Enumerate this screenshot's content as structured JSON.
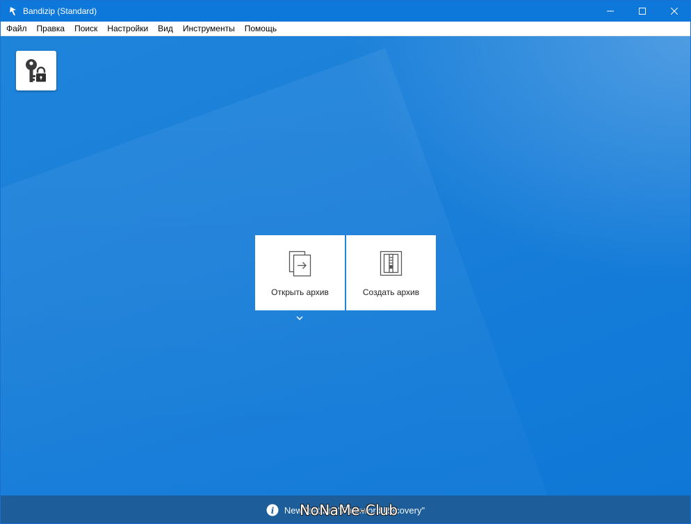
{
  "window": {
    "title": "Bandizip (Standard)",
    "accent_color": "#0d78d9",
    "controls": [
      "minimize-icon",
      "maximize-icon",
      "close-icon"
    ]
  },
  "menu": {
    "items": [
      "Файл",
      "Правка",
      "Поиск",
      "Настройки",
      "Вид",
      "Инструменты",
      "Помощь"
    ]
  },
  "main": {
    "password_manager_icon": "key-lock-icon",
    "actions": {
      "open_label": "Открыть архив",
      "open_icon": "open-archive-icon",
      "create_label": "Создать архив",
      "create_icon": "create-archive-icon"
    }
  },
  "status": {
    "text": "New feature: \"Password Recovery\"",
    "icon": "info-icon",
    "bar_color": "#1d5e9a"
  },
  "watermark": {
    "text": "NoNaMe-Club"
  }
}
